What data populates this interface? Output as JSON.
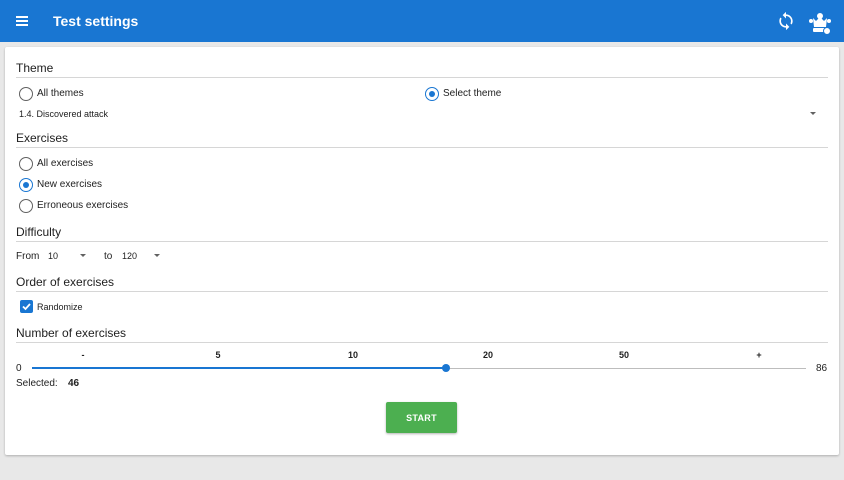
{
  "appbar": {
    "title": "Test settings"
  },
  "theme": {
    "heading": "Theme",
    "options": [
      {
        "label": "All themes",
        "selected": false
      },
      {
        "label": "Select theme",
        "selected": true
      }
    ],
    "selected_theme": "1.4. Discovered attack"
  },
  "exercises": {
    "heading": "Exercises",
    "options": [
      {
        "label": "All exercises",
        "selected": false
      },
      {
        "label": "New exercises",
        "selected": true
      },
      {
        "label": "Erroneous exercises",
        "selected": false
      }
    ]
  },
  "difficulty": {
    "heading": "Difficulty",
    "from_label": "From",
    "from_value": "10",
    "to_label": "to",
    "to_value": "120"
  },
  "order": {
    "heading": "Order of exercises",
    "randomize_label": "Randomize",
    "randomize_checked": true
  },
  "number": {
    "heading": "Number of exercises",
    "ticks": [
      "-",
      "5",
      "10",
      "20",
      "50",
      "+"
    ],
    "min": "0",
    "max": "86",
    "value": 46,
    "selected_label": "Selected:",
    "selected_value": "46"
  },
  "start_label": "START",
  "colors": {
    "primary": "#1976d2",
    "start": "#4caf50"
  }
}
